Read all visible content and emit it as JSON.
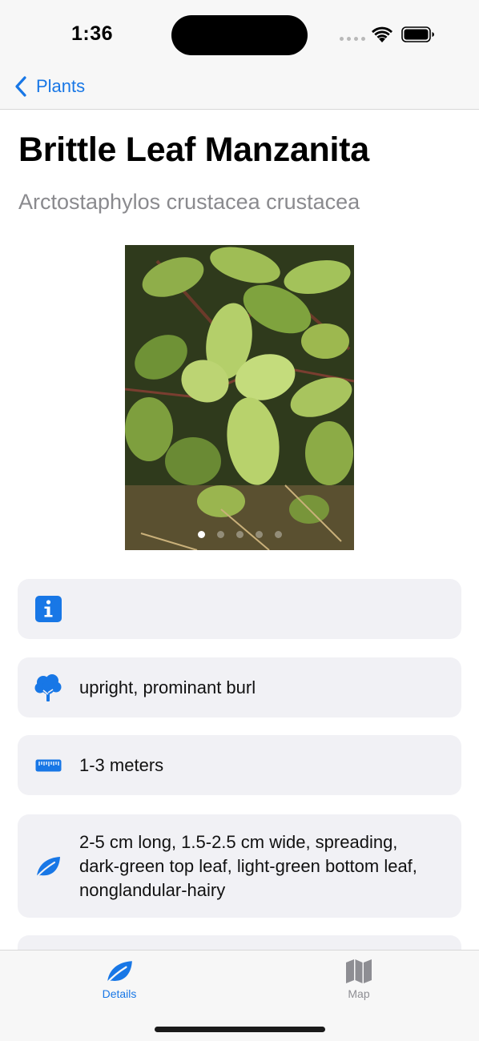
{
  "status_bar": {
    "time": "1:36"
  },
  "nav": {
    "back_label": "Plants"
  },
  "plant": {
    "common_name": "Brittle Leaf Manzanita",
    "scientific_name": "Arctostaphylos crustacea crustacea"
  },
  "gallery": {
    "image_alt": "Brittle Leaf Manzanita leaves",
    "page_count": 5,
    "current_page": 1
  },
  "details": [
    {
      "icon": "info-icon",
      "text": ""
    },
    {
      "icon": "tree-icon",
      "text": "upright, prominant burl"
    },
    {
      "icon": "ruler-icon",
      "text": "1-3 meters"
    },
    {
      "icon": "leaf-icon",
      "text": "2-5 cm long, 1.5-2.5 cm wide, spreading, dark-green top leaf, light-green bottom leaf, nonglandular-hairy"
    }
  ],
  "tabs": [
    {
      "label": "Details",
      "icon": "leaf-icon",
      "selected": true
    },
    {
      "label": "Map",
      "icon": "map-icon",
      "selected": false
    }
  ],
  "colors": {
    "accent": "#1877e6",
    "card_bg": "#f1f1f5",
    "secondary_text": "#8a8a8e",
    "inactive_tab": "#8e8e93"
  }
}
